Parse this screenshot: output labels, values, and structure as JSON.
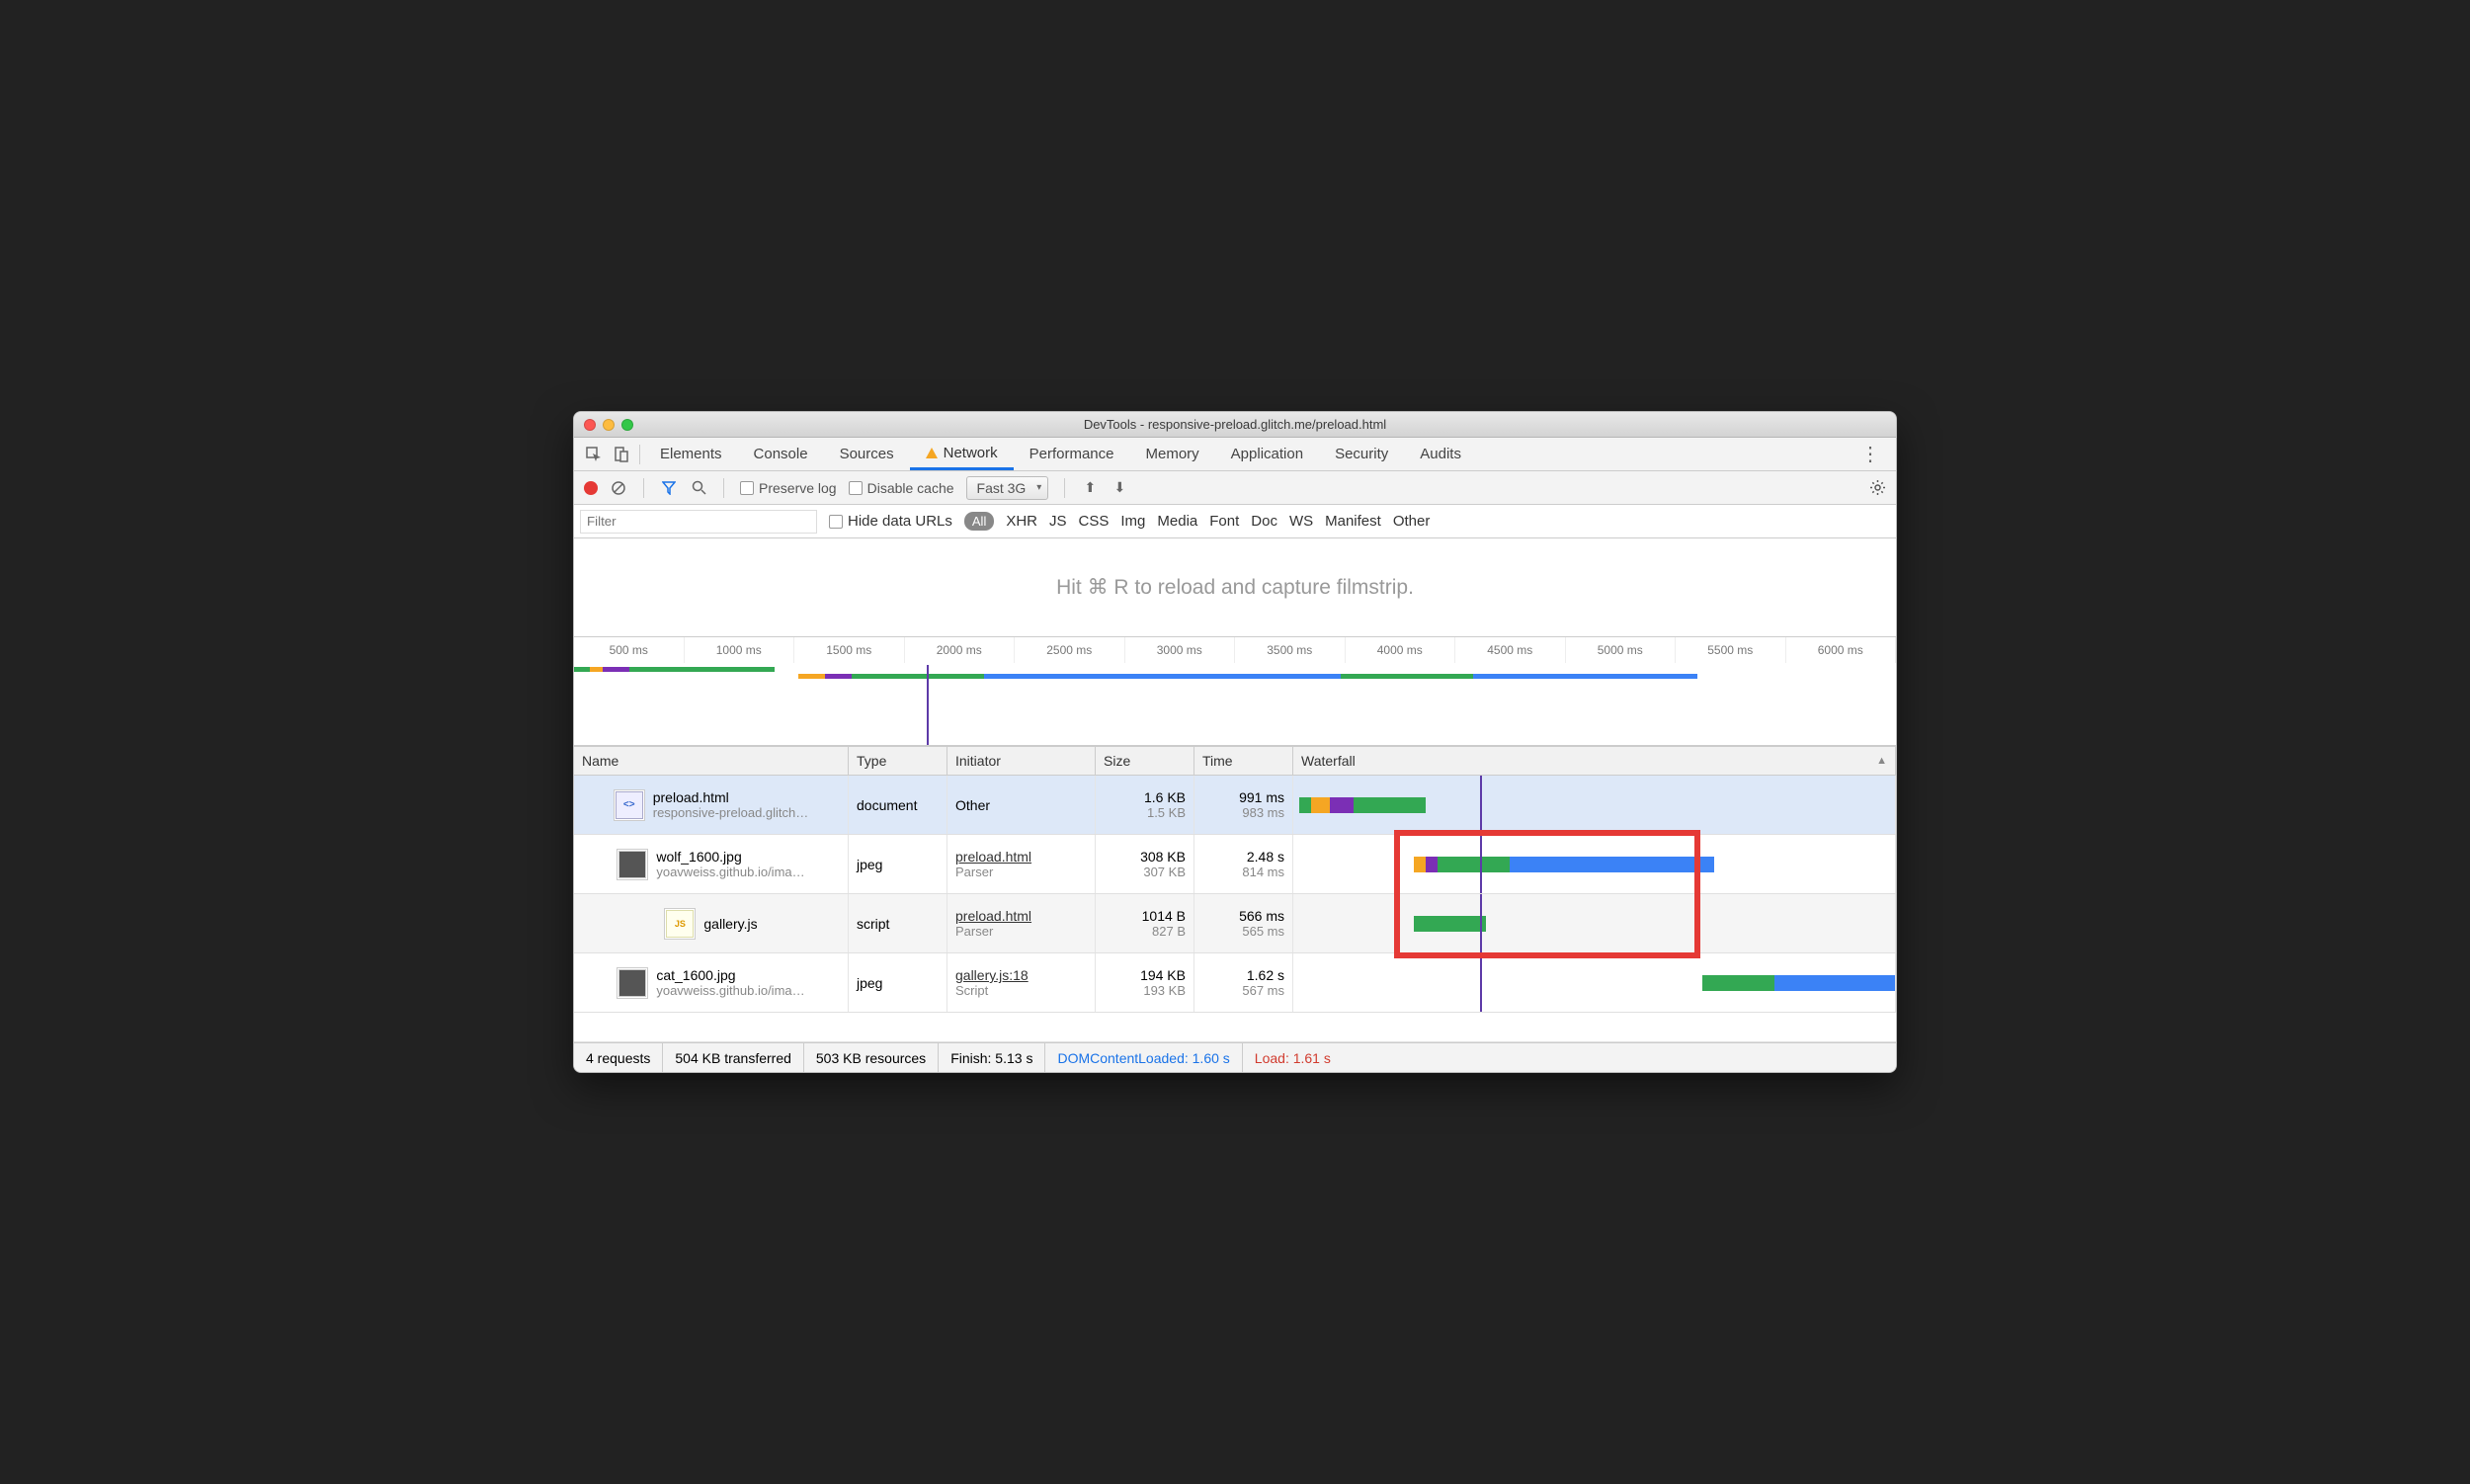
{
  "window": {
    "title": "DevTools - responsive-preload.glitch.me/preload.html"
  },
  "tabs": [
    "Elements",
    "Console",
    "Sources",
    "Network",
    "Performance",
    "Memory",
    "Application",
    "Security",
    "Audits"
  ],
  "activeTab": "Network",
  "warnTab": "Network",
  "toolbar": {
    "preserve": "Preserve log",
    "disable": "Disable cache",
    "throttle": "Fast 3G"
  },
  "filterbar": {
    "placeholder": "Filter",
    "hide": "Hide data URLs",
    "types": [
      "All",
      "XHR",
      "JS",
      "CSS",
      "Img",
      "Media",
      "Font",
      "Doc",
      "WS",
      "Manifest",
      "Other"
    ],
    "activeType": "All"
  },
  "filmstrip": "Hit ⌘ R to reload and capture filmstrip.",
  "timeline": {
    "ticks": [
      "500 ms",
      "1000 ms",
      "1500 ms",
      "2000 ms",
      "2500 ms",
      "3000 ms",
      "3500 ms",
      "4000 ms",
      "4500 ms",
      "5000 ms",
      "5500 ms",
      "6000 ms"
    ]
  },
  "columns": {
    "name": "Name",
    "type": "Type",
    "initiator": "Initiator",
    "size": "Size",
    "time": "Time",
    "waterfall": "Waterfall"
  },
  "rows": [
    {
      "name": "preload.html",
      "sub": "responsive-preload.glitch…",
      "type": "document",
      "initiator": "Other",
      "initiatorSub": "",
      "size": "1.6 KB",
      "sizeSub": "1.5 KB",
      "time": "991 ms",
      "timeSub": "983 ms",
      "icon": "html"
    },
    {
      "name": "wolf_1600.jpg",
      "sub": "yoavweiss.github.io/ima…",
      "type": "jpeg",
      "initiator": "preload.html",
      "initiatorSub": "Parser",
      "size": "308 KB",
      "sizeSub": "307 KB",
      "time": "2.48 s",
      "timeSub": "814 ms",
      "icon": "img"
    },
    {
      "name": "gallery.js",
      "sub": "",
      "type": "script",
      "initiator": "preload.html",
      "initiatorSub": "Parser",
      "size": "1014 B",
      "sizeSub": "827 B",
      "time": "566 ms",
      "timeSub": "565 ms",
      "icon": "js"
    },
    {
      "name": "cat_1600.jpg",
      "sub": "yoavweiss.github.io/ima…",
      "type": "jpeg",
      "initiator": "gallery.js:18",
      "initiatorSub": "Script",
      "size": "194 KB",
      "sizeSub": "193 KB",
      "time": "1.62 s",
      "timeSub": "567 ms",
      "icon": "img"
    }
  ],
  "status": {
    "requests": "4 requests",
    "transferred": "504 KB transferred",
    "resources": "503 KB resources",
    "finish": "Finish: 5.13 s",
    "dcl": "DOMContentLoaded: 1.60 s",
    "load": "Load: 1.61 s"
  },
  "chart_data": {
    "type": "table",
    "title": "Network waterfall overview",
    "x_unit": "ms",
    "xlim": [
      0,
      6000
    ],
    "markers": {
      "DOMContentLoaded_ms": 1600,
      "Load_ms": 1610
    },
    "requests": [
      {
        "name": "preload.html",
        "start_ms": 0,
        "total_ms": 991,
        "content_download_ms": 983,
        "type": "document"
      },
      {
        "name": "wolf_1600.jpg",
        "start_ms": 1000,
        "total_ms": 2480,
        "content_download_ms": 814,
        "type": "jpeg"
      },
      {
        "name": "gallery.js",
        "start_ms": 1020,
        "total_ms": 566,
        "content_download_ms": 565,
        "type": "script"
      },
      {
        "name": "cat_1600.jpg",
        "start_ms": 3510,
        "total_ms": 1620,
        "content_download_ms": 567,
        "type": "jpeg"
      }
    ]
  }
}
